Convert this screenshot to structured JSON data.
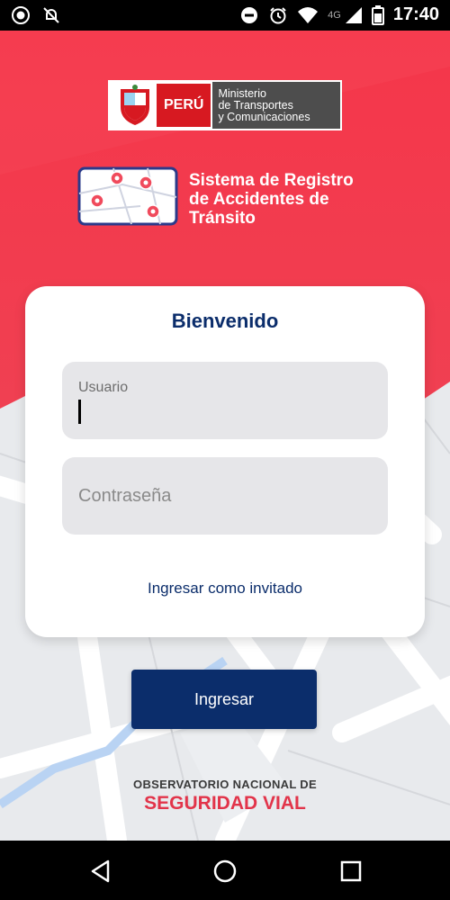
{
  "status_bar": {
    "time": "17:40",
    "network": "4G"
  },
  "header": {
    "peru_label": "PERÚ",
    "ministry_line1": "Ministerio",
    "ministry_line2": "de Transportes",
    "ministry_line3": "y Comunicaciones",
    "system_title_line1": "Sistema de Registro",
    "system_title_line2": "de Accidentes de",
    "system_title_line3": "Tránsito"
  },
  "login": {
    "welcome": "Bienvenido",
    "username_label": "Usuario",
    "username_value": "",
    "password_placeholder": "Contraseña",
    "guest_link": "Ingresar como invitado",
    "submit_label": "Ingresar"
  },
  "footer": {
    "line1": "OBSERVATORIO NACIONAL DE",
    "line2": "SEGURIDAD VIAL"
  },
  "colors": {
    "brand_red": "#f23a4c",
    "navy": "#0b2d6b",
    "field_bg": "#e6e6e9"
  }
}
